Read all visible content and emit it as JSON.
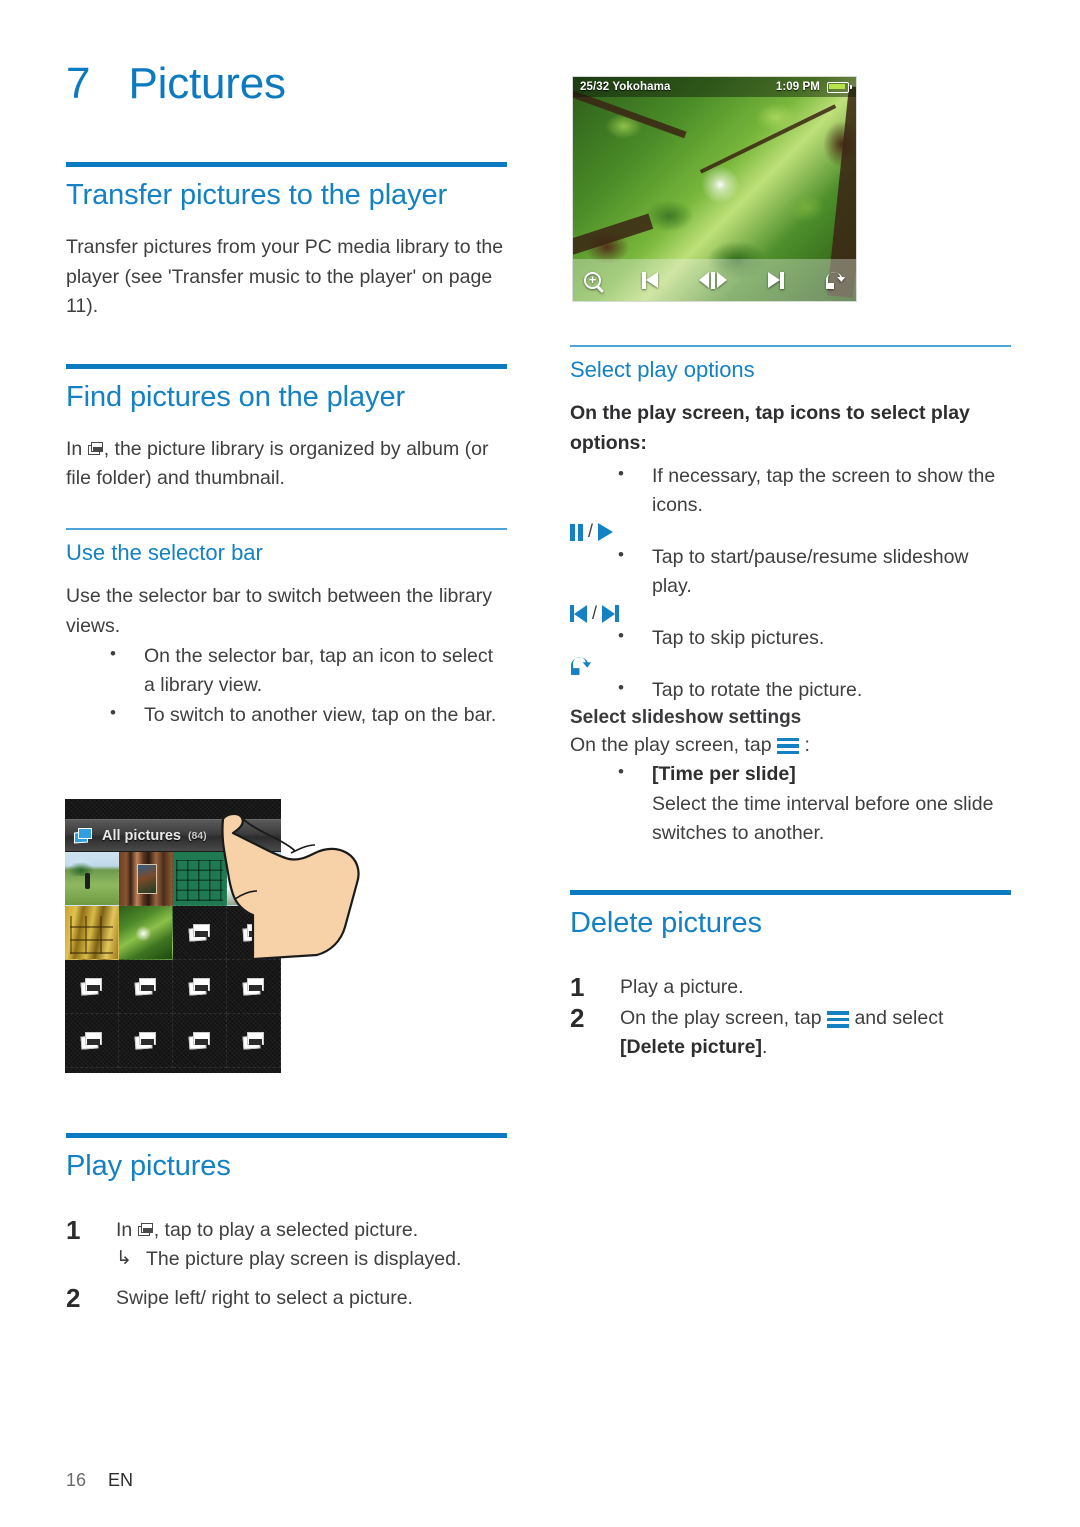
{
  "chapter": {
    "number": "7",
    "title": "Pictures"
  },
  "left_column": {
    "section_transfer": {
      "heading": "Transfer pictures to the player",
      "body": "Transfer pictures from your PC media library to the player (see 'Transfer music to the player' on page 11)."
    },
    "section_find": {
      "heading": "Find pictures on the player",
      "body_before_icon": "In ",
      "body_after_icon": ", the picture library is organized by album (or file folder) and thumbnail.",
      "icon": "pictures-library-icon"
    },
    "section_selector": {
      "heading": "Use the selector bar",
      "body": "Use the selector bar to switch between the library views.",
      "bullets": [
        "On the selector bar, tap an icon to select a library view.",
        "To switch to another view, tap on the bar."
      ]
    },
    "section_play": {
      "heading": "Play pictures",
      "steps": [
        {
          "num": "1",
          "text_before_icon": "In ",
          "text_after_icon": ", tap to play a selected picture.",
          "icon": "pictures-library-icon",
          "result_arrow": "↳",
          "result": "The picture play screen is displayed."
        },
        {
          "num": "2",
          "text": "Swipe left/ right to select a picture."
        }
      ]
    }
  },
  "right_column": {
    "section_play_options": {
      "heading": "Select play options",
      "lead": "On the play screen, tap icons to select play options:",
      "items": [
        {
          "icon": "",
          "icon_name": "none",
          "bullet": "If necessary, tap the screen to show the icons."
        },
        {
          "icon": "pause / play",
          "icon_name": "pause-play-icon",
          "bullet": "Tap to start/pause/resume slideshow play."
        },
        {
          "icon": "previous / next",
          "icon_name": "previous-next-icon",
          "bullet": "Tap to skip pictures."
        },
        {
          "icon": "rotate",
          "icon_name": "rotate-icon",
          "bullet": "Tap to rotate the picture."
        }
      ],
      "separator": "/"
    },
    "section_slideshow": {
      "heading": "Select slideshow settings",
      "lead_before_icon": "On the play screen, tap ",
      "lead_after_icon": ":",
      "menu_icon": "hamburger-menu-icon",
      "option_label": "[Time per slide]",
      "option_desc": "Select the time interval before one slide switches to another."
    },
    "section_delete": {
      "heading": "Delete pictures",
      "steps": [
        {
          "num": "1",
          "text": "Play a picture."
        },
        {
          "num": "2",
          "text_before_icon": "On the play screen, tap ",
          "menu_icon": "hamburger-menu-icon",
          "text_after_icon": " and select ",
          "bold_term": "[Delete picture]",
          "text_end": "."
        }
      ]
    }
  },
  "screenshot_play": {
    "name": "picture-play-screen",
    "status_left": "25/32 Yokohama",
    "status_time": "1:09 PM",
    "battery": "battery-icon",
    "controls": [
      {
        "name": "zoom-in-icon",
        "label": "zoom"
      },
      {
        "name": "previous-icon",
        "label": "previous"
      },
      {
        "name": "pause-icon",
        "label": "pause"
      },
      {
        "name": "next-icon",
        "label": "next"
      },
      {
        "name": "rotate-icon",
        "label": "rotate"
      }
    ]
  },
  "screenshot_library": {
    "name": "picture-library-screen",
    "selector_icon": "pictures-view-icon",
    "selector_label": "All pictures",
    "selector_count": "(84)",
    "grid_columns": 4,
    "grid_rows": 4,
    "cells": [
      "photo-park",
      "photo-wood",
      "photo-green-building",
      "photo-white-house",
      "photo-yellow-wall",
      "photo-sun-leaves",
      "placeholder",
      "placeholder",
      "placeholder",
      "placeholder",
      "placeholder",
      "placeholder",
      "placeholder",
      "placeholder",
      "placeholder",
      "placeholder"
    ],
    "pointer": "hand-pointer"
  },
  "footer": {
    "page_number": "16",
    "language": "EN"
  },
  "colors": {
    "accent_blue": "#0a7bc0",
    "heading_blue": "#1481c4",
    "rule_light": "#4ea3d8",
    "body_text": "#3f3f41"
  }
}
